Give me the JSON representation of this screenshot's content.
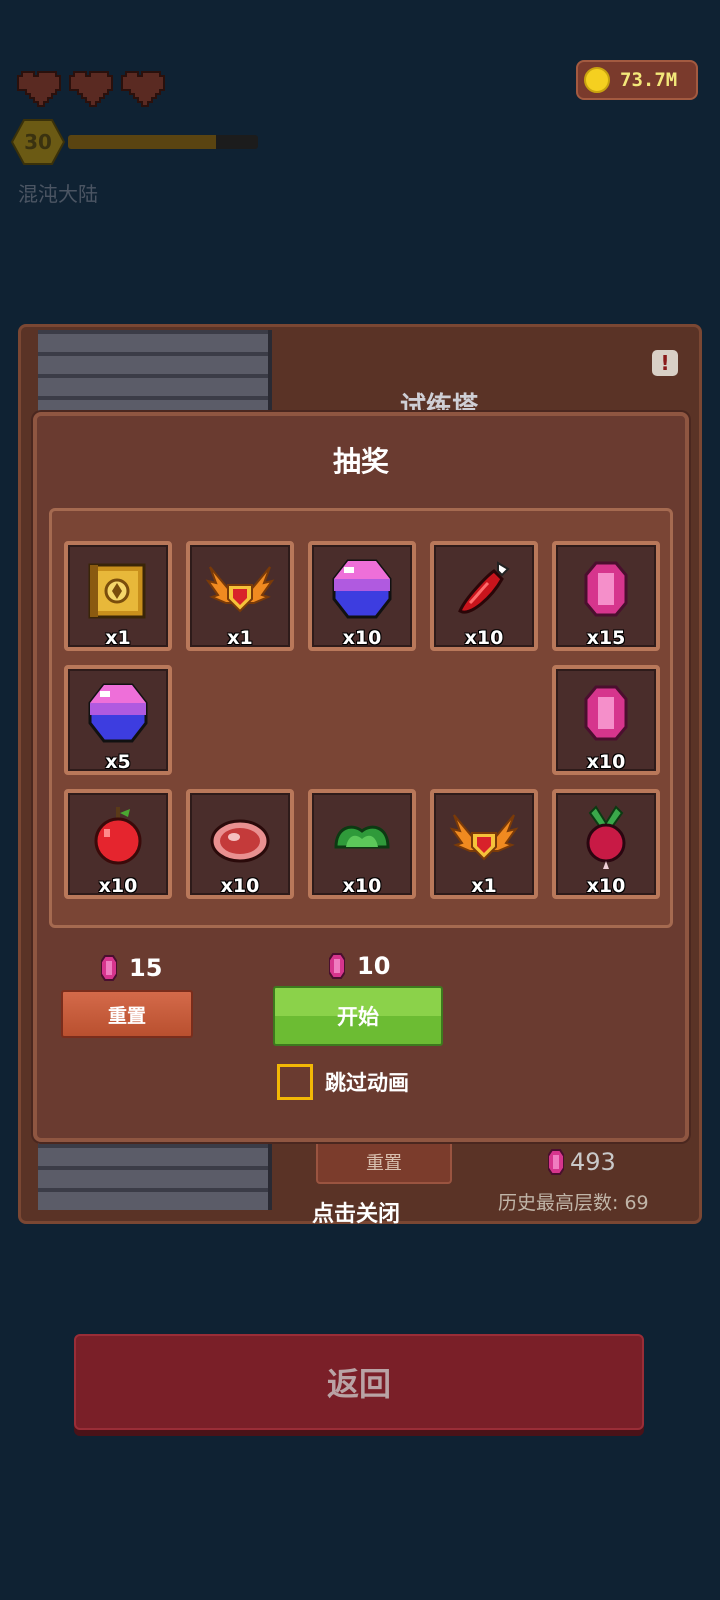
{
  "hud": {
    "level": "30",
    "xp_fraction": 0.78,
    "region": "混沌大陆",
    "coins": "73.7M",
    "hearts": [
      "heart-icon",
      "heart-icon",
      "heart-icon"
    ]
  },
  "tower": {
    "title": "试练塔",
    "reset_label": "重置",
    "gem_total": "493",
    "history_label": "历史最高层数: 69",
    "tap_close": "点击关闭"
  },
  "lottery": {
    "title": "抽奖",
    "items": [
      {
        "name": "golden-chest-icon",
        "qty": "x1"
      },
      {
        "name": "winged-badge-icon",
        "qty": "x1"
      },
      {
        "name": "blue-gem-icon",
        "qty": "x10"
      },
      {
        "name": "red-pepper-icon",
        "qty": "x10"
      },
      {
        "name": "pink-crystal-icon",
        "qty": "x15"
      },
      {
        "name": "blue-gem-icon",
        "qty": "x5"
      },
      {
        "name": "pink-crystal-icon",
        "qty": "x10"
      },
      {
        "name": "apple-icon",
        "qty": "x10"
      },
      {
        "name": "meat-icon",
        "qty": "x10"
      },
      {
        "name": "lettuce-icon",
        "qty": "x10"
      },
      {
        "name": "winged-badge-icon",
        "qty": "x1"
      },
      {
        "name": "radish-icon",
        "qty": "x10"
      }
    ],
    "reset_cost": "15",
    "reset_label": "重置",
    "start_cost": "10",
    "start_label": "开始",
    "skip_label": "跳过动画",
    "skip_checked": false
  },
  "footer": {
    "return_label": "返回"
  },
  "colors": {
    "background": "#0f2233",
    "panel": "#6a3b30",
    "start_green": "#6cbc33",
    "reset_orange": "#c55a3b",
    "return_red": "#7a1f28",
    "coin_text": "#f3e87a"
  }
}
